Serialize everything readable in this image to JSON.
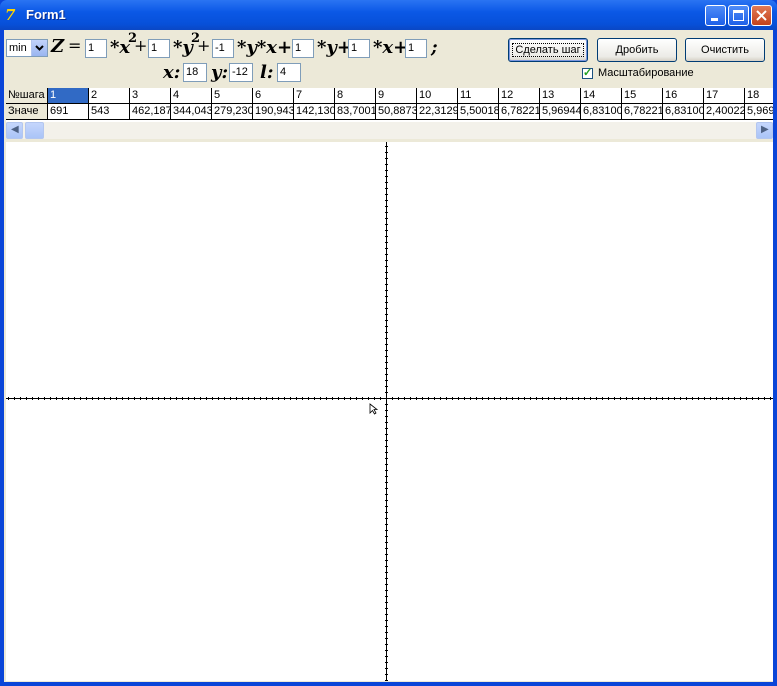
{
  "window": {
    "title": "Form1"
  },
  "formula": {
    "mode_select": "min",
    "z_label": "Z",
    "equals": "=",
    "coef_x2": "1",
    "coef_y2": "1",
    "coef_xy": "-1",
    "coef_y": "1",
    "coef_x": "1",
    "const": "1",
    "term_x": "*x",
    "term_y": "*y",
    "term_yx": "*y*x+",
    "term_ylin": "*y+",
    "term_xlin": "*x+",
    "exp2": "2",
    "plus": "+",
    "semicolon": ";",
    "x_label": "x:",
    "x_value": "18",
    "y_label": "y:",
    "y_value": "-12",
    "l_label": "l:",
    "l_value": "4"
  },
  "buttons": {
    "step": "Сделать шаг",
    "split": "Дробить",
    "clear": "Очистить"
  },
  "scaling": {
    "label": "Масштабирование",
    "checked": true
  },
  "grid": {
    "row_headers": [
      "№шага",
      "Значе"
    ],
    "steps": [
      "1",
      "2",
      "3",
      "4",
      "5",
      "6",
      "7",
      "8",
      "9",
      "10",
      "11",
      "12",
      "13",
      "14",
      "15",
      "16",
      "17",
      "18"
    ],
    "values": [
      "691",
      "543",
      "462,187",
      "344,043",
      "279,230",
      "190,943",
      "142,130",
      "83,7001",
      "50,8873",
      "22,3129",
      "5,50018",
      "6,78221",
      "5,96944",
      "6,83100",
      "6,78221",
      "6,83100",
      "2,40022",
      "5,969"
    ]
  },
  "colors": {
    "title_bar": "#0b58e6",
    "selected_cell": "#316ac5",
    "face": "#ece9d8"
  }
}
